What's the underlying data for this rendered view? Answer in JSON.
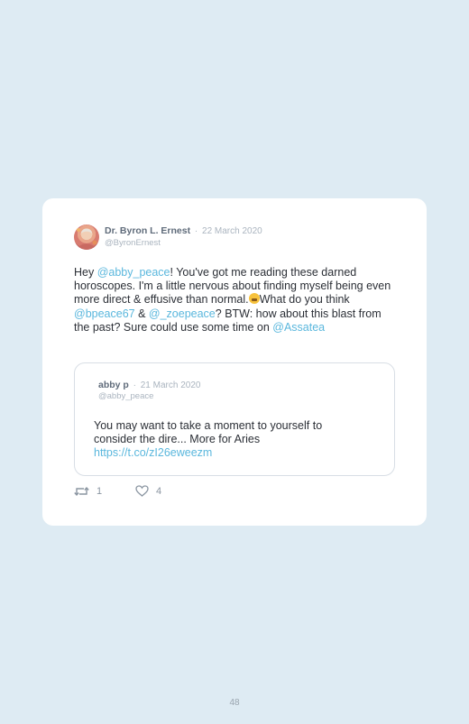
{
  "tweet": {
    "author": "Dr. Byron L. Ernest",
    "separator": "·",
    "date": "22 March 2020",
    "handle": "@ByronErnest",
    "text": {
      "p1": "Hey ",
      "m1": "@abby_peace",
      "p2": "! You've got me reading these darned horoscopes. I'm a little nervous about finding myself being even more direct & effusive than normal.",
      "p3": "What do you think ",
      "m2": "@bpeace67",
      "p4": " & ",
      "m3": "@_zoepeace",
      "p5": "? BTW: how about this blast from the past? Sure could use some time on ",
      "m4": "@Assatea"
    },
    "emoji": "grimacing-face-emoji",
    "retweets": "1",
    "likes": "4",
    "icons": {
      "retweet": "retweet-icon",
      "like": "heart-icon",
      "avatar": "avatar"
    },
    "colors": {
      "link": "#5ab7dd",
      "background": "#deebf3",
      "card": "#ffffff"
    }
  },
  "quoted": {
    "author": "abby p",
    "separator": "·",
    "date": "21 March 2020",
    "handle": "@abby_peace",
    "text": "You may want to take a moment to yourself to consider the dire... More for Aries",
    "link": "https://t.co/zI26eweezm"
  },
  "page": {
    "number": "48"
  }
}
